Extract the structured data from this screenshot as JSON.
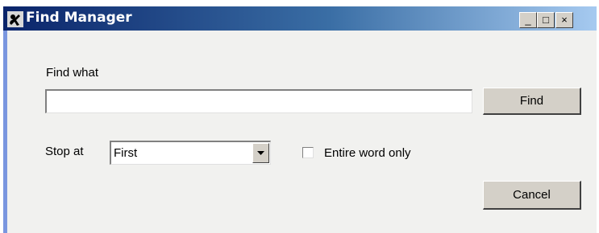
{
  "window": {
    "title": "Find Manager",
    "app_icon": "find-manager-app-icon",
    "controls": {
      "minimize": "_",
      "maximize": "□",
      "close": "×"
    }
  },
  "form": {
    "find_label": "Find what",
    "find_value": "",
    "find_button": "Find",
    "stop_label": "Stop at",
    "stop_value": "First",
    "entire_word_label": "Entire word only",
    "entire_word_checked": false,
    "cancel_button": "Cancel"
  },
  "colors": {
    "title_gradient_start": "#0a246a",
    "title_gradient_end": "#a6caf0",
    "window_face": "#f1f1ef",
    "button_face": "#d4d0c8"
  }
}
